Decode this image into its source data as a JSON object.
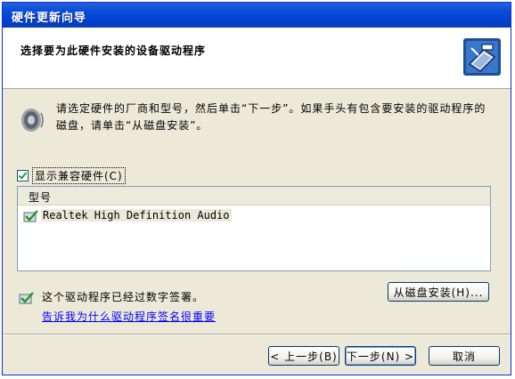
{
  "window": {
    "title": "硬件更新向导"
  },
  "header": {
    "heading": "选择要为此硬件安装的设备驱动程序"
  },
  "intro": {
    "text": "请选定硬件的厂商和型号，然后单击“下一步”。如果手头有包含要安装的驱动程序的磁盘，请单击“从磁盘安装”。"
  },
  "compat_checkbox": {
    "label": "显示兼容硬件(C)",
    "checked": true
  },
  "model_list": {
    "header": "型号",
    "items": [
      {
        "label": "Realtek High Definition Audio",
        "selected": true
      }
    ]
  },
  "signature": {
    "text": "这个驱动程序已经过数字签署。",
    "link": "告诉我为什么驱动程序签名很重要"
  },
  "buttons": {
    "have_disk": "从磁盘安装(H)...",
    "back": "< 上一步(B)",
    "next": "下一步(N) >",
    "cancel": "取消"
  },
  "colors": {
    "title_bar": "#0a4fd8",
    "dialog_bg": "#ece9d8",
    "link": "#0000ff"
  },
  "icons": {
    "header": "hardware-wizard-icon",
    "intro": "speaker-icon",
    "list_item": "driver-check-icon",
    "signature": "signed-driver-icon"
  }
}
